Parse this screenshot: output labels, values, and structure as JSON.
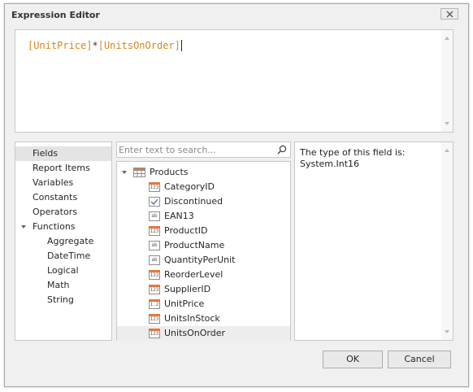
{
  "window": {
    "title": "Expression Editor"
  },
  "expression": {
    "part1": "[UnitPrice]",
    "operator": "*",
    "part2": "[UnitsOnOrder]"
  },
  "categories": [
    {
      "label": "Fields",
      "selected": true
    },
    {
      "label": "Report Items"
    },
    {
      "label": "Variables"
    },
    {
      "label": "Constants"
    },
    {
      "label": "Operators"
    },
    {
      "label": "Functions",
      "expanded": true
    },
    {
      "label": "Aggregate"
    },
    {
      "label": "DateTime"
    },
    {
      "label": "Logical"
    },
    {
      "label": "Math"
    },
    {
      "label": "String"
    }
  ],
  "search": {
    "placeholder": "Enter text to search..."
  },
  "tree": {
    "root": "Products",
    "fields": [
      {
        "label": "CategoryID",
        "icon": "123"
      },
      {
        "label": "Discontinued",
        "icon": "check"
      },
      {
        "label": "EAN13",
        "icon": "ab"
      },
      {
        "label": "ProductID",
        "icon": "123"
      },
      {
        "label": "ProductName",
        "icon": "ab"
      },
      {
        "label": "QuantityPerUnit",
        "icon": "ab"
      },
      {
        "label": "ReorderLevel",
        "icon": "123"
      },
      {
        "label": "SupplierID",
        "icon": "123"
      },
      {
        "label": "UnitPrice",
        "icon": "1.2"
      },
      {
        "label": "UnitsInStock",
        "icon": "123"
      },
      {
        "label": "UnitsOnOrder",
        "icon": "123",
        "selected": true
      }
    ]
  },
  "description": {
    "line1": "The type of this field is:",
    "line2": "System.Int16"
  },
  "buttons": {
    "ok": "OK",
    "cancel": "Cancel"
  },
  "colors": {
    "field_token": "#d6861c",
    "numeric_icon_accent": "#e07a3a",
    "selection": "#e4e4e4"
  }
}
